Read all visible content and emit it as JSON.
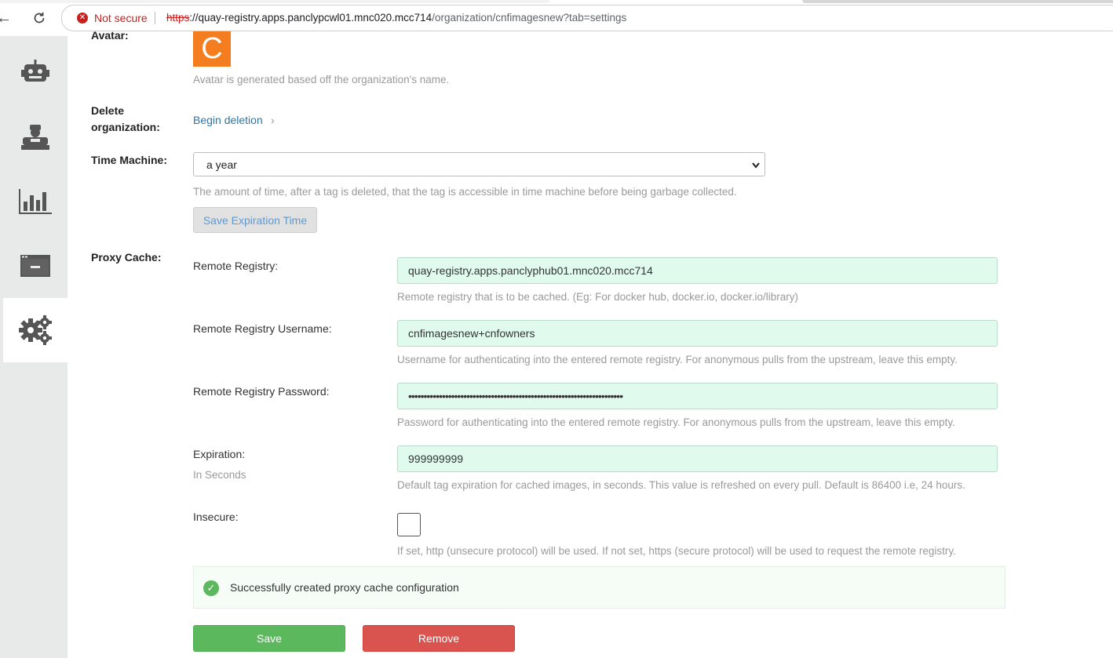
{
  "browser": {
    "security_label": "Not secure",
    "url_scheme": "https",
    "url_host": "://quay-registry.apps.panclypcwl01.mnc020.mcc714",
    "url_path": "/organization/cnfimagesnew?tab=settings"
  },
  "sidebar": {
    "items": [
      {
        "icon": "robot-icon"
      },
      {
        "icon": "user-teams-icon"
      },
      {
        "icon": "usage-logs-icon"
      },
      {
        "icon": "applications-icon"
      },
      {
        "icon": "settings-gears-icon",
        "active": true
      }
    ]
  },
  "avatar": {
    "label": "Avatar:",
    "letter": "C",
    "color": "#f47d20",
    "help": "Avatar is generated based off the organization's name."
  },
  "delete_org": {
    "label_line1": "Delete",
    "label_line2": "organization:",
    "link": "Begin deletion",
    "chevron": "›"
  },
  "time_machine": {
    "label": "Time Machine:",
    "selected": "a year",
    "help": "The amount of time, after a tag is deleted, that the tag is accessible in time machine before being garbage collected.",
    "save_label": "Save Expiration Time"
  },
  "proxy_cache": {
    "label": "Proxy Cache:",
    "remote_registry": {
      "label": "Remote Registry:",
      "value": "quay-registry.apps.panclyphub01.mnc020.mcc714",
      "help": "Remote registry that is to be cached. (Eg: For docker hub, docker.io, docker.io/library)"
    },
    "username": {
      "label": "Remote Registry Username:",
      "value": "cnfimagesnew+cnfowners",
      "help": "Username for authenticating into the entered remote registry. For anonymous pulls from the upstream, leave this empty."
    },
    "password": {
      "label": "Remote Registry Password:",
      "value": "••••••••••••••••••••••••••••••••••••••••••••••••••••••••••••••••••••••",
      "help": "Password for authenticating into the entered remote registry. For anonymous pulls from the upstream, leave this empty."
    },
    "expiration": {
      "label": "Expiration:",
      "sub_label": "In Seconds",
      "value": "999999999",
      "help": "Default tag expiration for cached images, in seconds. This value is refreshed on every pull. Default is 86400 i.e, 24 hours."
    },
    "insecure": {
      "label": "Insecure:",
      "checked": false,
      "help": "If set, http (unsecure protocol) will be used. If not set, https (secure protocol) will be used to request the remote registry."
    },
    "alert": "Successfully created proxy cache configuration",
    "save_label": "Save",
    "remove_label": "Remove"
  },
  "colors": {
    "success": "#5cb85c",
    "danger": "#d9534f",
    "link": "#2a74a8",
    "input_bg": "#e0fbee"
  }
}
